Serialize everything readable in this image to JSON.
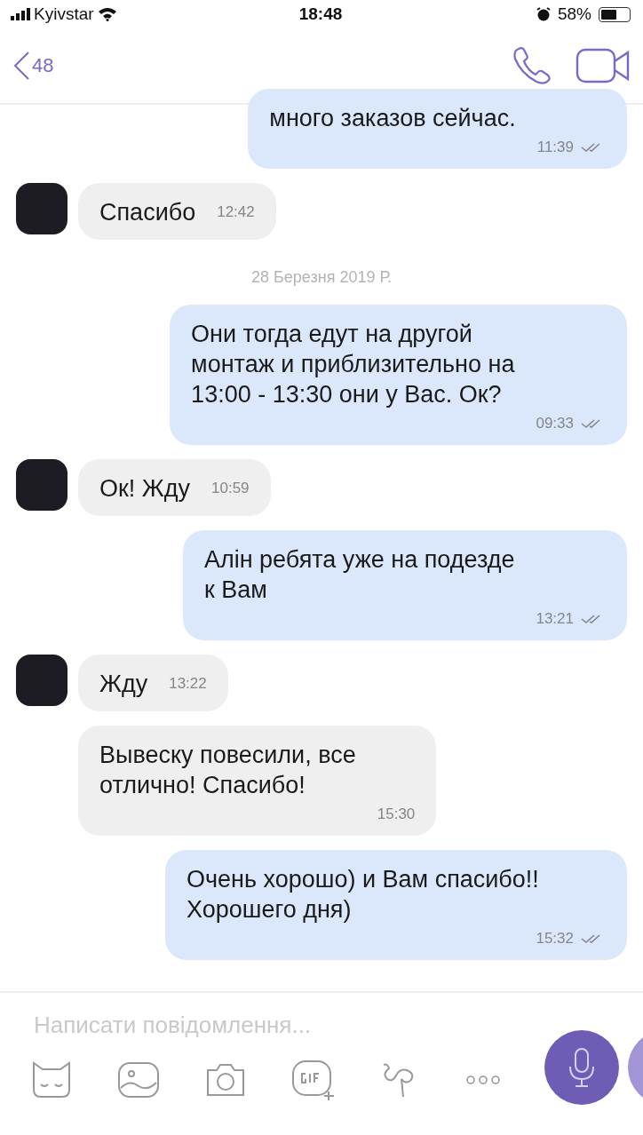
{
  "status_bar": {
    "carrier": "Kyivstar",
    "time": "18:48",
    "battery": "58%"
  },
  "header": {
    "back_count": "48"
  },
  "messages": [
    {
      "kind": "outgoing",
      "text": "много заказов сейчас.",
      "time": "11:39",
      "read": true
    },
    {
      "kind": "incoming",
      "avatar": true,
      "text": "Спасибо",
      "time": "12:42"
    },
    {
      "kind": "date",
      "text": "28 Березня 2019 Р."
    },
    {
      "kind": "outgoing",
      "text": "Они тогда едут на другой\nмонтаж и приблизительно на\n13:00 - 13:30 они у Вас. Ок?",
      "time": "09:33",
      "read": true
    },
    {
      "kind": "incoming",
      "avatar": true,
      "text": "Ок! Жду",
      "time": "10:59"
    },
    {
      "kind": "outgoing",
      "text": "Алін ребята уже на подезде\nк Вам",
      "time": "13:21",
      "read": true
    },
    {
      "kind": "incoming",
      "avatar": true,
      "text": "Жду",
      "time": "13:22"
    },
    {
      "kind": "incoming",
      "avatar": false,
      "text": "Вывеску повесили, все\nотлично! Спасибо!",
      "time": "15:30"
    },
    {
      "kind": "outgoing",
      "text": "Очень хорошо) и Вам спасибо!!\nХорошего дня)",
      "time": "15:32",
      "read": true
    }
  ],
  "composer": {
    "placeholder": "Написати повідомлення..."
  }
}
